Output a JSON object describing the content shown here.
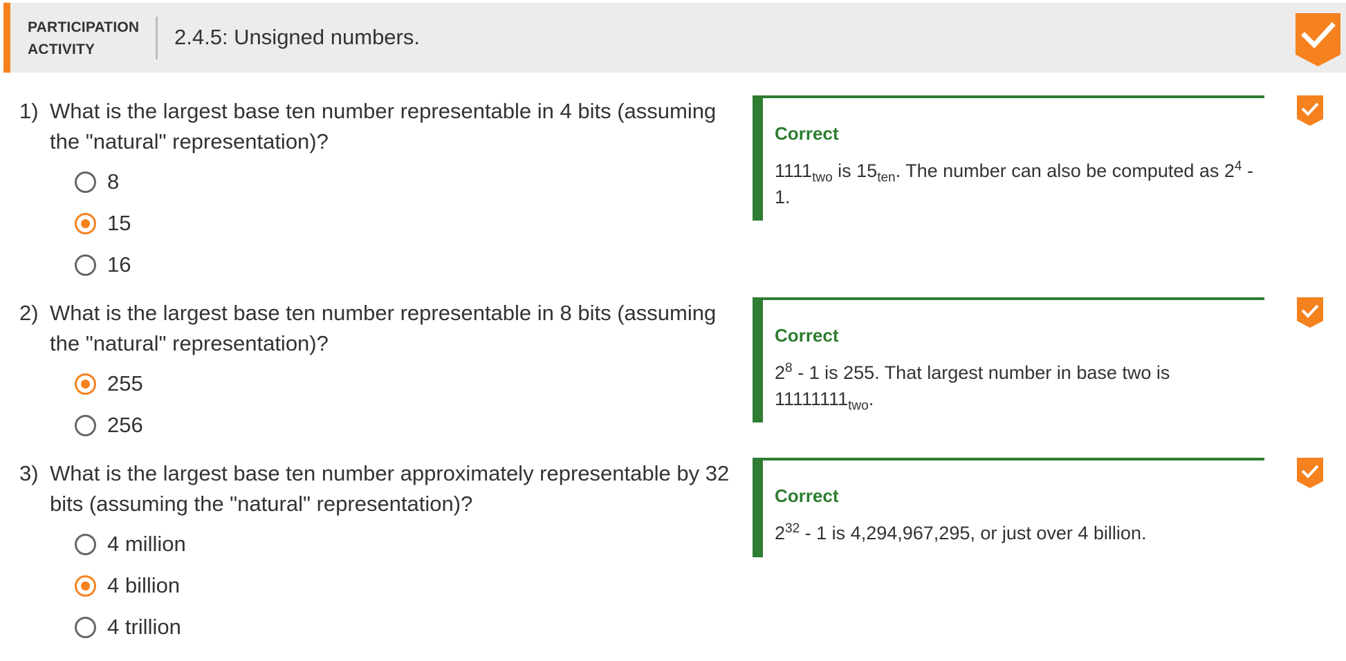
{
  "header": {
    "kind_line1": "PARTICIPATION",
    "kind_line2": "ACTIVITY",
    "title": "2.4.5: Unsigned numbers.",
    "complete_icon": "check-icon",
    "accent_color": "#f5821f"
  },
  "feedback_color": "#2e7d32",
  "questions": [
    {
      "number": "1)",
      "text": "What is the largest base ten number representable in 4 bits (assuming the \"natural\" representation)?",
      "choices": [
        {
          "label": "8",
          "selected": false
        },
        {
          "label": "15",
          "selected": true
        },
        {
          "label": "16",
          "selected": false
        }
      ],
      "feedback": {
        "title": "Correct",
        "parts": {
          "a": "1111",
          "a_sub": "two",
          "b": " is 15",
          "b_sub": "ten",
          "c": ". The number can also be computed as 2",
          "c_sup": "4",
          "d": " - 1."
        }
      }
    },
    {
      "number": "2)",
      "text": "What is the largest base ten number representable in 8 bits (assuming the \"natural\" representation)?",
      "choices": [
        {
          "label": "255",
          "selected": true
        },
        {
          "label": "256",
          "selected": false
        }
      ],
      "feedback": {
        "title": "Correct",
        "parts": {
          "a": "2",
          "a_sup": "8",
          "b": " - 1 is 255. That largest number in base two is 11111111",
          "b_sub": "two",
          "c": "."
        }
      }
    },
    {
      "number": "3)",
      "text": "What is the largest base ten number approximately representable by 32 bits (assuming the \"natural\" representation)?",
      "choices": [
        {
          "label": "4 million",
          "selected": false
        },
        {
          "label": "4 billion",
          "selected": true
        },
        {
          "label": "4 trillion",
          "selected": false
        }
      ],
      "feedback": {
        "title": "Correct",
        "parts": {
          "a": "2",
          "a_sup": "32",
          "b": " - 1 is 4,294,967,295, or just over 4 billion."
        }
      }
    }
  ]
}
